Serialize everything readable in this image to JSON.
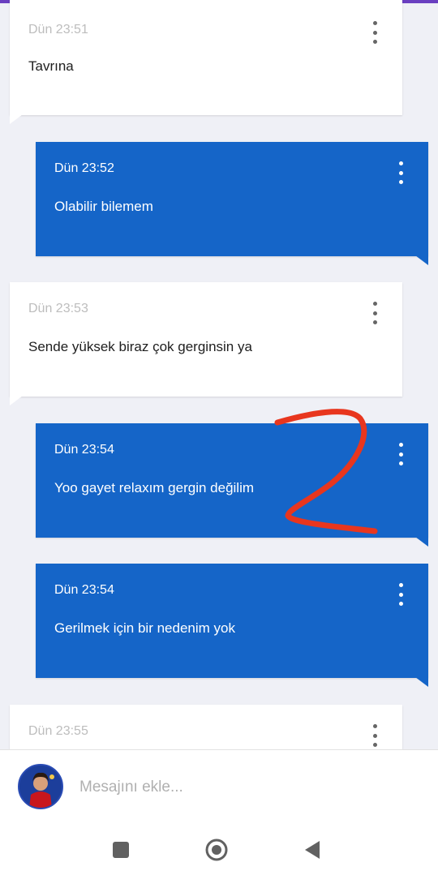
{
  "colors": {
    "incoming_bg": "#ffffff",
    "outgoing_bg": "#1565c8",
    "accent_top": "#6a3fc0",
    "annotation": "#e8361e"
  },
  "messages": [
    {
      "direction": "in",
      "time": "Dün 23:51",
      "text": "Tavrına"
    },
    {
      "direction": "out",
      "time": "Dün 23:52",
      "text": "Olabilir bilemem"
    },
    {
      "direction": "in",
      "time": "Dün 23:53",
      "text": "Sende yüksek biraz çok gerginsin ya"
    },
    {
      "direction": "out",
      "time": "Dün 23:54",
      "text": "Yoo gayet relaxım gergin değilim"
    },
    {
      "direction": "out",
      "time": "Dün 23:54",
      "text": "Gerilmek için bir nedenim yok"
    },
    {
      "direction": "in",
      "time": "Dün 23:55",
      "text": ""
    }
  ],
  "composer": {
    "placeholder": "Mesajını ekle...",
    "value": ""
  },
  "icons": {
    "message_menu": "more-vert-icon",
    "nav_recents": "square-icon",
    "nav_home": "circle-icon",
    "nav_back": "triangle-back-icon"
  }
}
